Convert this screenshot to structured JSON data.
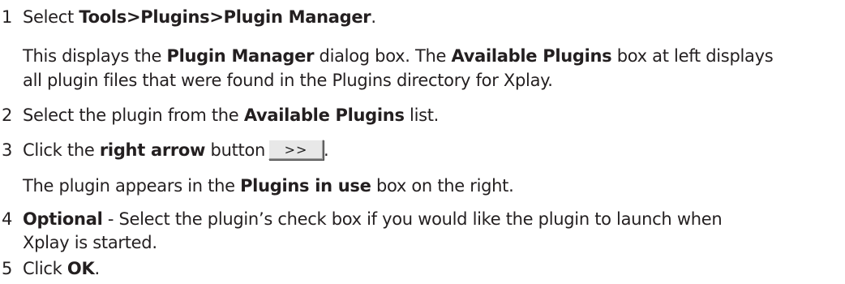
{
  "steps": [
    {
      "number": "1",
      "instruction": {
        "prefix": "Select ",
        "tools_path": "Tools>Plugins>Plugin Manager",
        "suffix": "."
      },
      "details": {
        "line1": {
          "a": "This displays the ",
          "b": "Plugin Manager",
          "c": " dialog box. The ",
          "d": "Available Plugins",
          "e": " box at left displays"
        },
        "line2": "all plugin files that were found in the Plugins directory for Xplay."
      }
    },
    {
      "number": "2",
      "instruction": {
        "a": "Select the plugin from the ",
        "b": "Available Plugins",
        "c": " list."
      }
    },
    {
      "number": "3",
      "instruction": {
        "a": "Click the ",
        "b": "right arrow",
        "c": " button",
        "d": "."
      },
      "button_glyph": ">>",
      "details": {
        "a": "The plugin appears in the ",
        "b": "Plugins in use",
        "c": " box on the right."
      }
    },
    {
      "number": "4",
      "instruction": {
        "a": "Optional",
        "b": " - Select the plugin’s check box if you would like the plugin to launch when",
        "line2": "Xplay is started."
      }
    },
    {
      "number": "5",
      "instruction": {
        "a": "Click ",
        "b": "OK",
        "c": "."
      }
    }
  ]
}
